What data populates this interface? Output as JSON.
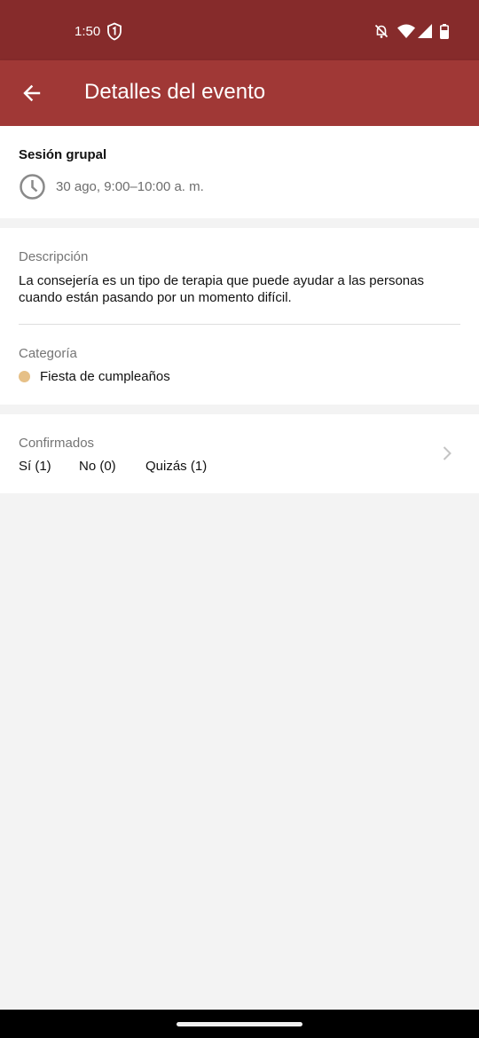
{
  "status_bar": {
    "time": "1:50",
    "icons": [
      "shield-icon",
      "notifications-off-icon",
      "wifi-icon",
      "signal-icon",
      "battery-icon"
    ]
  },
  "app_bar": {
    "title": "Detalles del evento",
    "back_icon": "arrow-back-icon",
    "background": "#a03836"
  },
  "event": {
    "title": "Sesión grupal",
    "time": "30 ago, 9:00–10:00 a. m."
  },
  "details": {
    "description_label": "Descripción",
    "description": "La consejería es un tipo de terapia que puede ayudar a las personas cuando están pasando por un momento difícil.",
    "category_label": "Categoría",
    "category": "Fiesta de cumpleaños",
    "category_color": "#e6c087"
  },
  "attendance": {
    "label": "Confirmados",
    "yes": "Sí (1)",
    "no": "No (0)",
    "maybe": "Quizás (1)"
  }
}
